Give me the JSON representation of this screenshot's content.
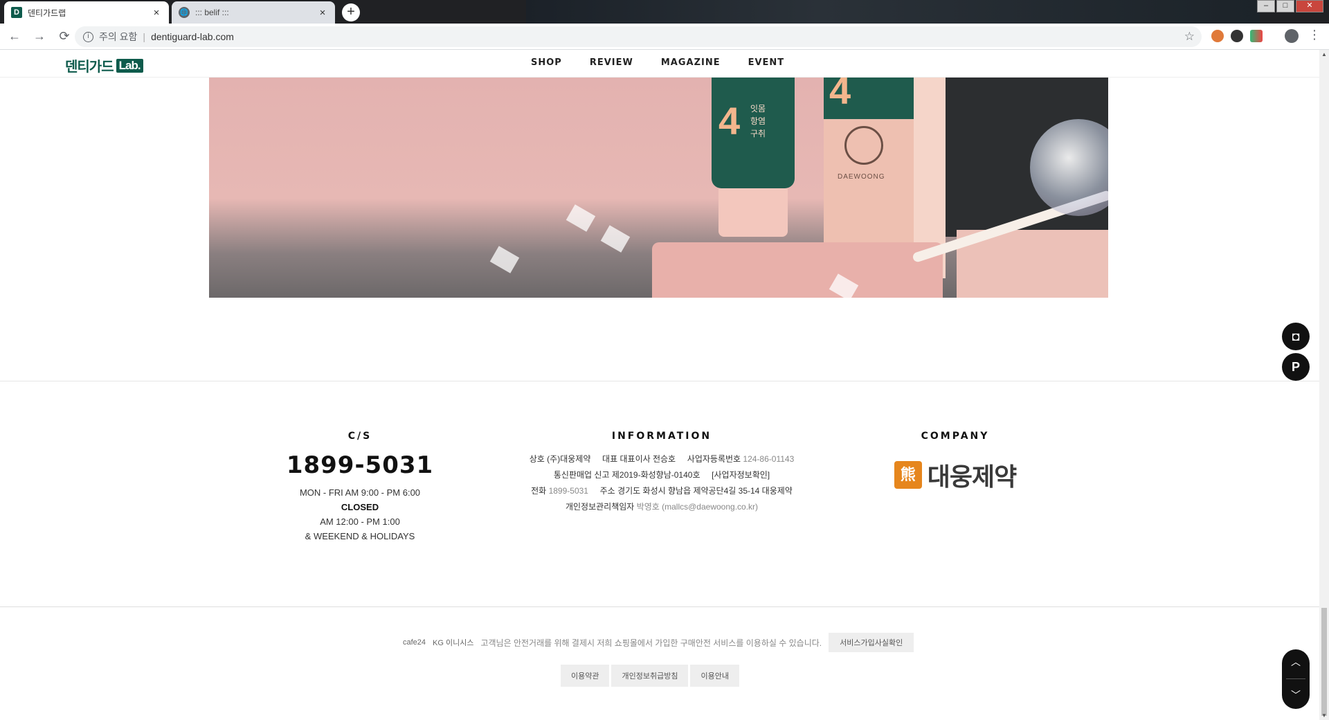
{
  "browser": {
    "tabs": [
      {
        "title": "덴티가드랩",
        "favicon": "D",
        "close": "×"
      },
      {
        "title": "::: belif :::",
        "favicon": "🌐",
        "close": "×"
      }
    ],
    "new_tab": "+",
    "window_controls": [
      "–",
      "□",
      "✕"
    ],
    "nav": {
      "back": "←",
      "forward": "→",
      "reload": "⟳"
    },
    "address": {
      "security_icon": "i",
      "security_label": "주의 요함",
      "separator": "|",
      "url": "dentiguard-lab.com",
      "bookmark_icon": "☆"
    },
    "menu_icon": "⋮"
  },
  "site": {
    "logo_text": "덴티가드",
    "logo_badge": "Lab.",
    "nav": [
      "SHOP",
      "REVIEW",
      "MAGAZINE",
      "EVENT"
    ]
  },
  "hero": {
    "tube_number": "4",
    "tube_text": "잇몸\n항염\n구취",
    "box_number": "4",
    "box_brand": "DAEWOONG"
  },
  "floating": {
    "instagram": "◘",
    "plus": "P"
  },
  "footer": {
    "cs": {
      "heading": "C/S",
      "phone": "1899-5031",
      "hours": "MON - FRI AM 9:00 - PM 6:00",
      "closed": "CLOSED",
      "lunch": "AM 12:00 - PM 1:00",
      "holidays": "& WEEKEND & HOLIDAYS"
    },
    "information": {
      "heading": "INFORMATION",
      "company_label": "상호",
      "company_value": "(주)대웅제약",
      "ceo_label": "대표",
      "ceo_value": "대표이사 전승호",
      "biz_label": "사업자등록번호",
      "biz_value": "124-86-01143",
      "mail_order_label": "통신판매업 신고",
      "mail_order_value": "제2019-화성향남-0140호",
      "biz_check": "[사업자정보확인]",
      "phone_label": "전화",
      "phone_value": "1899-5031",
      "address_label": "주소",
      "address_value": "경기도 화성시 향남읍 제약공단4길 35-14 대웅제약",
      "privacy_label": "개인정보관리책임자",
      "privacy_value": "박영호 (mallcs@daewoong.co.kr)"
    },
    "company": {
      "heading": "COMPANY",
      "logo_mark": "熊",
      "logo_name": "대웅제약"
    },
    "escrow": {
      "cafe24": "cafe24",
      "kg": "KG 이니시스",
      "notice": "고객님은 안전거래를 위해 결제시 저희 쇼핑몰에서 가입한 구매안전 서비스를 이용하실 수 있습니다.",
      "verify_button": "서비스가입사실확인"
    },
    "links": [
      "이용약관",
      "개인정보취급방침",
      "이용안내"
    ]
  },
  "scroll": {
    "up": "︿",
    "down": "﹀"
  }
}
